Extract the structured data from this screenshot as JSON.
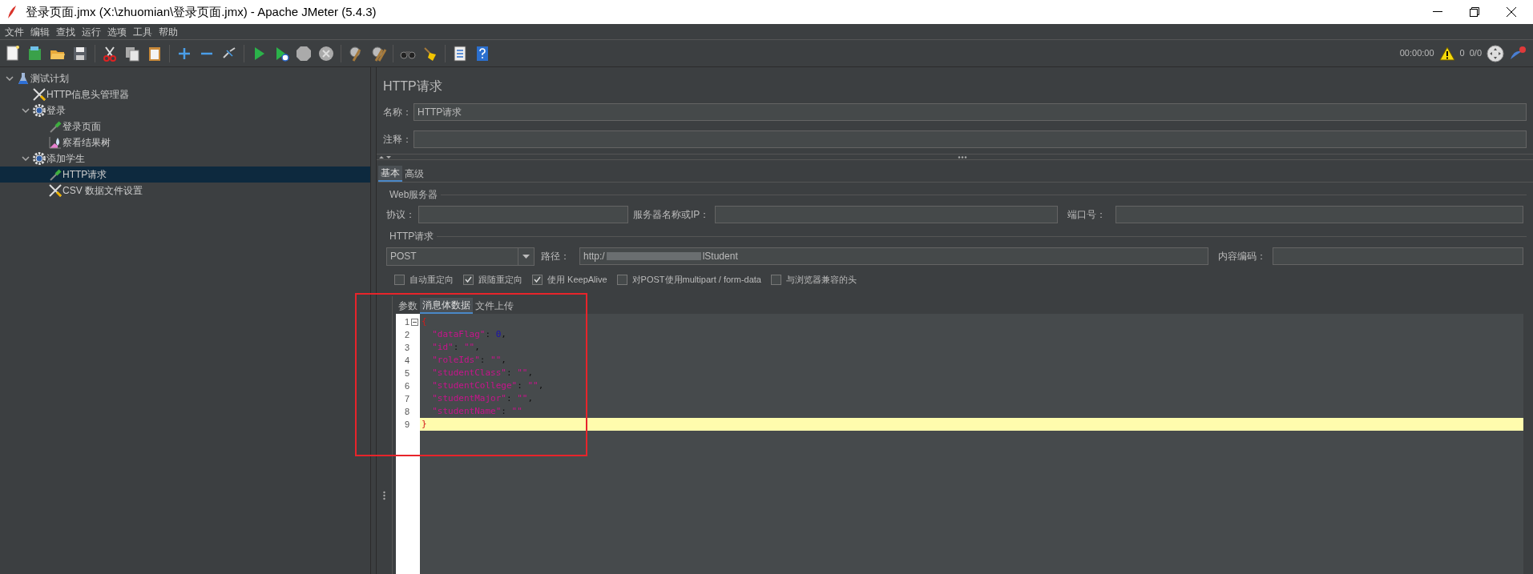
{
  "window": {
    "title": "登录页面.jmx (X:\\zhuomian\\登录页面.jmx) - Apache JMeter (5.4.3)"
  },
  "menu": [
    "文件",
    "编辑",
    "查找",
    "运行",
    "选项",
    "工具",
    "帮助"
  ],
  "status": {
    "time": "00:00:00",
    "warnings": "0",
    "threads": "0/0"
  },
  "tree": [
    {
      "label": "测试计划",
      "kind": "plan",
      "selected": false,
      "expanded": true,
      "children": [
        {
          "label": "HTTP信息头管理器",
          "kind": "config",
          "selected": false
        },
        {
          "label": "登录",
          "kind": "group",
          "selected": false,
          "expanded": true,
          "children": [
            {
              "label": "登录页面",
              "kind": "sampler",
              "selected": false
            },
            {
              "label": "察看结果树",
              "kind": "listener",
              "selected": false
            }
          ]
        },
        {
          "label": "添加学生",
          "kind": "group",
          "selected": false,
          "expanded": true,
          "children": [
            {
              "label": "HTTP请求",
              "kind": "sampler",
              "selected": true
            },
            {
              "label": "CSV 数据文件设置",
              "kind": "config",
              "selected": false
            }
          ]
        }
      ]
    }
  ],
  "panel": {
    "title": "HTTP请求",
    "name_label": "名称：",
    "name_value": "HTTP请求",
    "comment_label": "注释：",
    "tabs": [
      {
        "label": "基本",
        "selected": true
      },
      {
        "label": "高级",
        "selected": false
      }
    ],
    "web_server": {
      "legend": "Web服务器",
      "protocol_label": "协议：",
      "server_label": "服务器名称或IP：",
      "port_label": "端口号："
    },
    "http_request": {
      "legend": "HTTP请求",
      "method": "POST",
      "path_label": "路径：",
      "path_start": "http:/",
      "path_end": "lStudent",
      "encoding_label": "内容编码："
    },
    "options": [
      {
        "label": "自动重定向",
        "checked": false
      },
      {
        "label": "跟随重定向",
        "checked": true
      },
      {
        "label": "使用 KeepAlive",
        "checked": true
      },
      {
        "label": "对POST使用multipart / form-data",
        "checked": false
      },
      {
        "label": "与浏览器兼容的头",
        "checked": false
      }
    ],
    "body_tabs": [
      {
        "label": "参数",
        "selected": false
      },
      {
        "label": "消息体数据",
        "selected": true
      },
      {
        "label": "文件上传",
        "selected": false
      }
    ],
    "body_lines": [
      {
        "number": "1",
        "text": "{",
        "current": false,
        "fold": true
      },
      {
        "number": "2",
        "text": "  \"dataFlag\": 0,",
        "current": false,
        "fold": false
      },
      {
        "number": "3",
        "text": "  \"id\": \"\",",
        "current": false,
        "fold": false
      },
      {
        "number": "4",
        "text": "  \"roleIds\": \"\",",
        "current": false,
        "fold": false
      },
      {
        "number": "5",
        "text": "  \"studentClass\": \"\",",
        "current": false,
        "fold": false
      },
      {
        "number": "6",
        "text": "  \"studentCollege\": \"\",",
        "current": false,
        "fold": false
      },
      {
        "number": "7",
        "text": "  \"studentMajor\": \"\",",
        "current": false,
        "fold": false
      },
      {
        "number": "8",
        "text": "  \"studentName\": \"\"",
        "current": false,
        "fold": false
      },
      {
        "number": "9",
        "text": "}",
        "current": true,
        "fold": false
      }
    ]
  },
  "annotation_box": true
}
